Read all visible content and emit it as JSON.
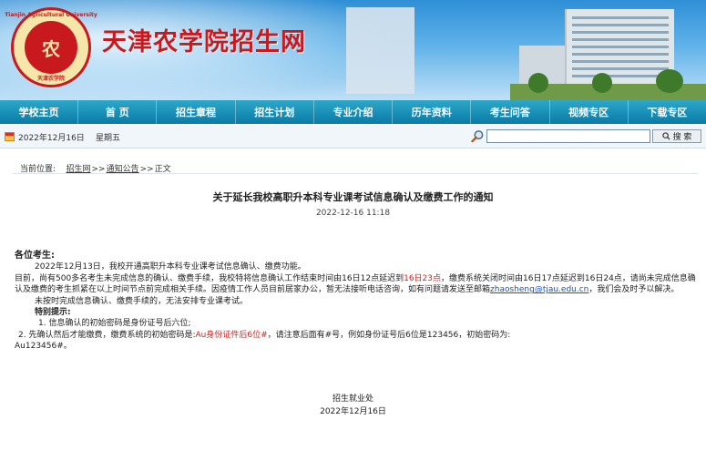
{
  "header": {
    "site_title": "天津农学院招生网",
    "logo_ring_top": "Tianjin Agricultural University",
    "logo_ring_bottom": "天津农学院",
    "logo_center": "农"
  },
  "nav": [
    {
      "label": "学校主页"
    },
    {
      "label": "首 页"
    },
    {
      "label": "招生章程"
    },
    {
      "label": "招生计划"
    },
    {
      "label": "专业介绍"
    },
    {
      "label": "历年资料"
    },
    {
      "label": "考生问答"
    },
    {
      "label": "视频专区"
    },
    {
      "label": "下载专区"
    }
  ],
  "infobar": {
    "date": "2022年12月16日",
    "weekday": "星期五",
    "search_placeholder": "",
    "search_button": "搜 索"
  },
  "breadcrumb": {
    "prefix": "当前位置:",
    "home": "招生网",
    "sep1": ">>",
    "section": "通知公告",
    "sep2": ">>",
    "current": "正文"
  },
  "article": {
    "title": "关于延长我校高职升本科专业课考试信息确认及缴费工作的通知",
    "time": "2022-12-16  11:18",
    "greeting": "各位考生:",
    "p1": "2022年12月13日，我校开通高职升本科专业课考试信息确认、缴费功能。",
    "p2_a": "目前，尚有500多名考生未完成信息的确认、缴费手续，我校特将信息确认工作结束时间由16日12点延迟到",
    "p2_red": "16日23点",
    "p2_b": "，缴费系统关闭时间由16日17点延迟到16日24点，请尚未完成信息确认及缴费的考生抓紧在以上时间节点前完成相关手续。因疫情工作人员目前居家办公，暂无法接听电话咨询，如有问题请发送至邮箱",
    "p2_email": "zhaosheng@tjau.edu.cn",
    "p2_c": "，我们会及时予以解决。",
    "p3": "未按时完成信息确认、缴费手续的，无法安排专业课考试。",
    "tip_title": "特别提示:",
    "tip1": "1. 信息确认的初始密码是身份证号后六位;",
    "tip2_a": "2. 先确认然后才能缴费，缴费系统的初始密码是:",
    "tip2_red": "Au身份证件后6位#",
    "tip2_b": "，请注意后面有#号，例如身份证号后6位是123456，初始密码为:",
    "tip2_c": "Au123456#。",
    "sign_dept": "招生就业处",
    "sign_date": "2022年12月16日"
  }
}
